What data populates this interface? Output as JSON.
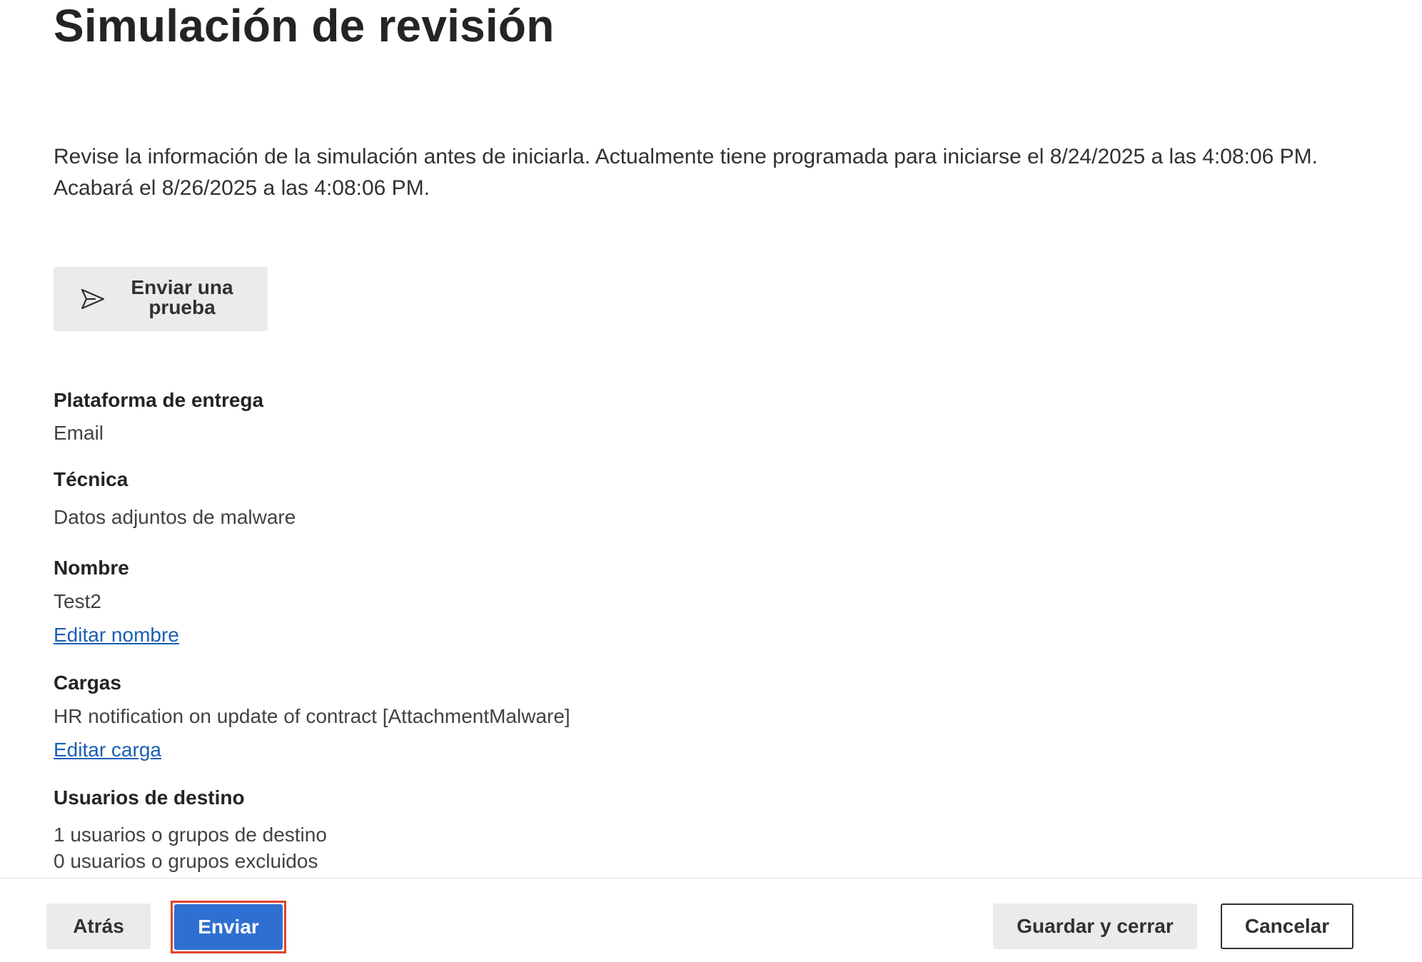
{
  "page": {
    "title": "Simulación de revisión",
    "intro": "Revise la información de la simulación antes de iniciarla. Actualmente tiene programada para iniciarse el 8/24/2025 a las 4:08:06 PM. Acabará el 8/26/2025 a las 4:08:06 PM."
  },
  "test_button": {
    "label": "Enviar una prueba",
    "icon": "send-icon"
  },
  "sections": {
    "platform": {
      "label": "Plataforma de entrega",
      "value": "Email"
    },
    "technique": {
      "label": "Técnica",
      "value": "Datos adjuntos de malware"
    },
    "name": {
      "label": "Nombre",
      "value": "Test2",
      "edit_link": "Editar nombre"
    },
    "payloads": {
      "label": "Cargas",
      "value": "HR notification on update of contract [AttachmentMalware]",
      "edit_link": "Editar carga"
    },
    "target_users": {
      "label": "Usuarios de destino",
      "included": "1 usuarios o grupos de destino",
      "excluded": "0 usuarios o grupos excluidos"
    }
  },
  "footer": {
    "back_label": "Atrás",
    "submit_label": "Enviar",
    "save_close_label": "Guardar y cerrar",
    "cancel_label": "Cancelar"
  },
  "colors": {
    "primary": "#2f6fd1",
    "link": "#1a5fb4",
    "highlight": "#e0442b",
    "secondary_button": "#ebebeb"
  }
}
